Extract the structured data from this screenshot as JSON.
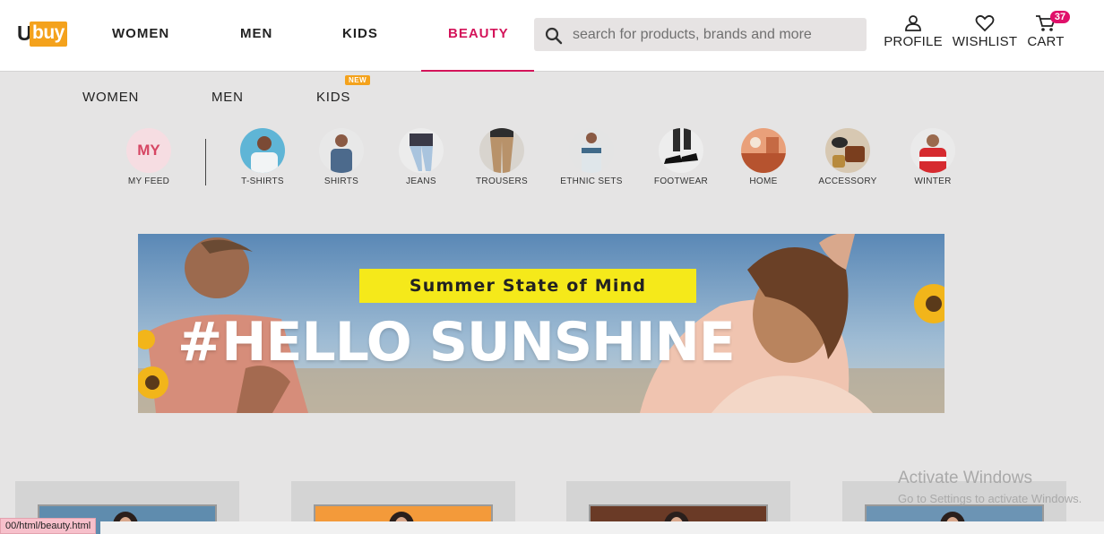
{
  "brand": {
    "logo_text_prefix": "U",
    "logo_text_box": "buy",
    "accent_color": "#d4145a",
    "logo_color": "#f4a21c"
  },
  "header": {
    "nav": [
      "WOMEN",
      "MEN",
      "KIDS",
      "BEAUTY"
    ],
    "active_nav": "BEAUTY",
    "search_placeholder": "search for products, brands and more",
    "profile_label": "PROFILE",
    "wishlist_label": "WISHLIST",
    "cart_label": "CART",
    "cart_count": "37"
  },
  "subnav": {
    "items": [
      "WOMEN",
      "MEN",
      "KIDS"
    ],
    "new_badge": "NEW"
  },
  "categories": {
    "my_feed": {
      "circle_text": "MY",
      "label": "MY FEED"
    },
    "items": [
      {
        "label": "T-SHIRTS",
        "icon": "tshirt-thumb"
      },
      {
        "label": "SHIRTS",
        "icon": "shirt-thumb"
      },
      {
        "label": "JEANS",
        "icon": "jeans-thumb"
      },
      {
        "label": "TROUSERS",
        "icon": "trousers-thumb"
      },
      {
        "label": "ETHNIC SETS",
        "icon": "ethnic-thumb"
      },
      {
        "label": "FOOTWEAR",
        "icon": "footwear-thumb"
      },
      {
        "label": "HOME",
        "icon": "home-thumb"
      },
      {
        "label": "ACCESSORY",
        "icon": "accessory-thumb"
      },
      {
        "label": "WINTER",
        "icon": "winter-thumb"
      }
    ]
  },
  "banner": {
    "tagline": "Summer State of Mind",
    "headline": "#HELLO SUNSHINE"
  },
  "overlays": {
    "windows_title": "Activate Windows",
    "windows_sub": "Go to Settings to activate Windows.",
    "status_url": "00/html/beauty.html"
  }
}
